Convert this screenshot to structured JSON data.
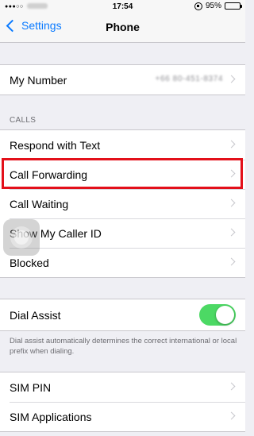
{
  "status_bar": {
    "carrier": "●●●○○",
    "time": "17:54",
    "battery": "95%",
    "battery_level": 0.95
  },
  "nav": {
    "back_label": "Settings",
    "title": "Phone"
  },
  "my_number": {
    "label": "My Number",
    "value": "+66 80-451-8374"
  },
  "calls_section": {
    "header": "CALLS",
    "items": [
      {
        "label": "Respond with Text"
      },
      {
        "label": "Call Forwarding"
      },
      {
        "label": "Call Waiting"
      },
      {
        "label": "Show My Caller ID"
      },
      {
        "label": "Blocked"
      }
    ]
  },
  "dial_assist": {
    "label": "Dial Assist",
    "enabled": true,
    "toggle_color": "#4cd964",
    "footer": "Dial assist automatically determines the correct international or local prefix when dialing."
  },
  "sim_section": {
    "items": [
      {
        "label": "SIM PIN"
      },
      {
        "label": "SIM Applications"
      }
    ]
  },
  "highlight_color": "#e3101a",
  "accent_color": "#0a7aff"
}
